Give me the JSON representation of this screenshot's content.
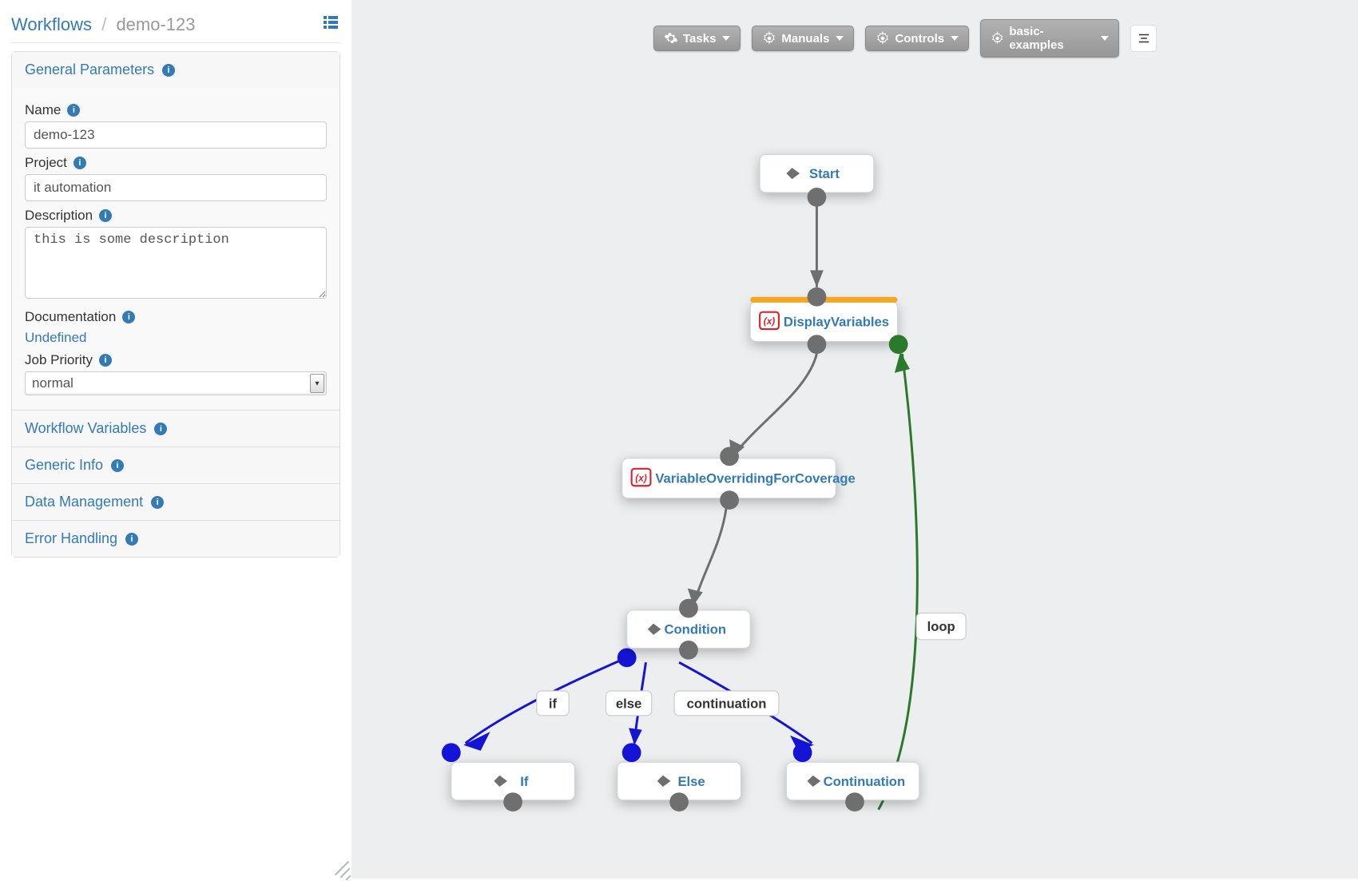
{
  "breadcrumb": {
    "root": "Workflows",
    "current": "demo-123"
  },
  "sections": {
    "general_params": "General Parameters",
    "workflow_vars": "Workflow Variables",
    "generic_info": "Generic Info",
    "data_mgmt": "Data Management",
    "error_handling": "Error Handling"
  },
  "labels": {
    "name": "Name",
    "project": "Project",
    "description": "Description",
    "documentation": "Documentation",
    "job_priority": "Job Priority"
  },
  "form": {
    "name": "demo-123",
    "project": "it automation",
    "description": "this is some description",
    "documentation_link": "Undefined",
    "job_priority": "normal"
  },
  "toolbar": {
    "tasks": "Tasks",
    "manuals": "Manuals",
    "controls": "Controls",
    "palette": "basic-examples"
  },
  "graph": {
    "nodes": {
      "start": "Start",
      "display_vars": "DisplayVariables",
      "var_override": "VariableOverridingForCoverage",
      "condition": "Condition",
      "if": "If",
      "else": "Else",
      "continuation": "Continuation"
    },
    "branch_labels": {
      "if": "if",
      "else": "else",
      "continuation": "continuation"
    },
    "edge_labels": {
      "loop": "loop"
    }
  }
}
